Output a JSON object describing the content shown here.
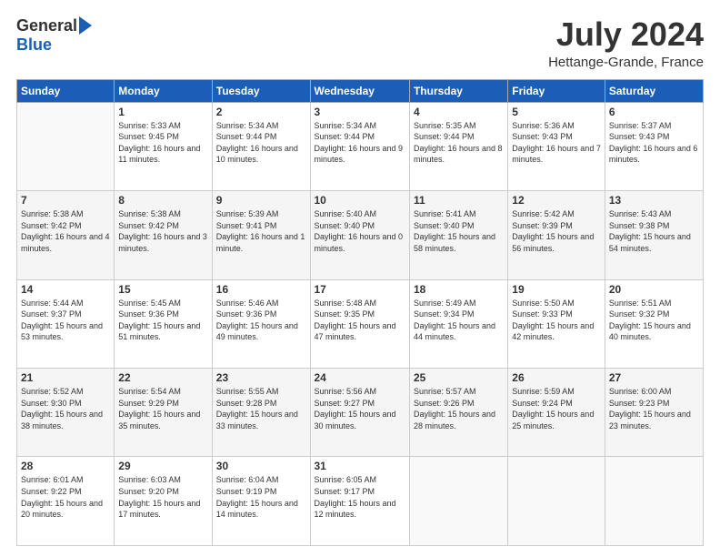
{
  "logo": {
    "general": "General",
    "blue": "Blue"
  },
  "header": {
    "month": "July 2024",
    "location": "Hettange-Grande, France"
  },
  "weekdays": [
    "Sunday",
    "Monday",
    "Tuesday",
    "Wednesday",
    "Thursday",
    "Friday",
    "Saturday"
  ],
  "weeks": [
    [
      {
        "day": "",
        "sunrise": "",
        "sunset": "",
        "daylight": ""
      },
      {
        "day": "1",
        "sunrise": "Sunrise: 5:33 AM",
        "sunset": "Sunset: 9:45 PM",
        "daylight": "Daylight: 16 hours and 11 minutes."
      },
      {
        "day": "2",
        "sunrise": "Sunrise: 5:34 AM",
        "sunset": "Sunset: 9:44 PM",
        "daylight": "Daylight: 16 hours and 10 minutes."
      },
      {
        "day": "3",
        "sunrise": "Sunrise: 5:34 AM",
        "sunset": "Sunset: 9:44 PM",
        "daylight": "Daylight: 16 hours and 9 minutes."
      },
      {
        "day": "4",
        "sunrise": "Sunrise: 5:35 AM",
        "sunset": "Sunset: 9:44 PM",
        "daylight": "Daylight: 16 hours and 8 minutes."
      },
      {
        "day": "5",
        "sunrise": "Sunrise: 5:36 AM",
        "sunset": "Sunset: 9:43 PM",
        "daylight": "Daylight: 16 hours and 7 minutes."
      },
      {
        "day": "6",
        "sunrise": "Sunrise: 5:37 AM",
        "sunset": "Sunset: 9:43 PM",
        "daylight": "Daylight: 16 hours and 6 minutes."
      }
    ],
    [
      {
        "day": "7",
        "sunrise": "Sunrise: 5:38 AM",
        "sunset": "Sunset: 9:42 PM",
        "daylight": "Daylight: 16 hours and 4 minutes."
      },
      {
        "day": "8",
        "sunrise": "Sunrise: 5:38 AM",
        "sunset": "Sunset: 9:42 PM",
        "daylight": "Daylight: 16 hours and 3 minutes."
      },
      {
        "day": "9",
        "sunrise": "Sunrise: 5:39 AM",
        "sunset": "Sunset: 9:41 PM",
        "daylight": "Daylight: 16 hours and 1 minute."
      },
      {
        "day": "10",
        "sunrise": "Sunrise: 5:40 AM",
        "sunset": "Sunset: 9:40 PM",
        "daylight": "Daylight: 16 hours and 0 minutes."
      },
      {
        "day": "11",
        "sunrise": "Sunrise: 5:41 AM",
        "sunset": "Sunset: 9:40 PM",
        "daylight": "Daylight: 15 hours and 58 minutes."
      },
      {
        "day": "12",
        "sunrise": "Sunrise: 5:42 AM",
        "sunset": "Sunset: 9:39 PM",
        "daylight": "Daylight: 15 hours and 56 minutes."
      },
      {
        "day": "13",
        "sunrise": "Sunrise: 5:43 AM",
        "sunset": "Sunset: 9:38 PM",
        "daylight": "Daylight: 15 hours and 54 minutes."
      }
    ],
    [
      {
        "day": "14",
        "sunrise": "Sunrise: 5:44 AM",
        "sunset": "Sunset: 9:37 PM",
        "daylight": "Daylight: 15 hours and 53 minutes."
      },
      {
        "day": "15",
        "sunrise": "Sunrise: 5:45 AM",
        "sunset": "Sunset: 9:36 PM",
        "daylight": "Daylight: 15 hours and 51 minutes."
      },
      {
        "day": "16",
        "sunrise": "Sunrise: 5:46 AM",
        "sunset": "Sunset: 9:36 PM",
        "daylight": "Daylight: 15 hours and 49 minutes."
      },
      {
        "day": "17",
        "sunrise": "Sunrise: 5:48 AM",
        "sunset": "Sunset: 9:35 PM",
        "daylight": "Daylight: 15 hours and 47 minutes."
      },
      {
        "day": "18",
        "sunrise": "Sunrise: 5:49 AM",
        "sunset": "Sunset: 9:34 PM",
        "daylight": "Daylight: 15 hours and 44 minutes."
      },
      {
        "day": "19",
        "sunrise": "Sunrise: 5:50 AM",
        "sunset": "Sunset: 9:33 PM",
        "daylight": "Daylight: 15 hours and 42 minutes."
      },
      {
        "day": "20",
        "sunrise": "Sunrise: 5:51 AM",
        "sunset": "Sunset: 9:32 PM",
        "daylight": "Daylight: 15 hours and 40 minutes."
      }
    ],
    [
      {
        "day": "21",
        "sunrise": "Sunrise: 5:52 AM",
        "sunset": "Sunset: 9:30 PM",
        "daylight": "Daylight: 15 hours and 38 minutes."
      },
      {
        "day": "22",
        "sunrise": "Sunrise: 5:54 AM",
        "sunset": "Sunset: 9:29 PM",
        "daylight": "Daylight: 15 hours and 35 minutes."
      },
      {
        "day": "23",
        "sunrise": "Sunrise: 5:55 AM",
        "sunset": "Sunset: 9:28 PM",
        "daylight": "Daylight: 15 hours and 33 minutes."
      },
      {
        "day": "24",
        "sunrise": "Sunrise: 5:56 AM",
        "sunset": "Sunset: 9:27 PM",
        "daylight": "Daylight: 15 hours and 30 minutes."
      },
      {
        "day": "25",
        "sunrise": "Sunrise: 5:57 AM",
        "sunset": "Sunset: 9:26 PM",
        "daylight": "Daylight: 15 hours and 28 minutes."
      },
      {
        "day": "26",
        "sunrise": "Sunrise: 5:59 AM",
        "sunset": "Sunset: 9:24 PM",
        "daylight": "Daylight: 15 hours and 25 minutes."
      },
      {
        "day": "27",
        "sunrise": "Sunrise: 6:00 AM",
        "sunset": "Sunset: 9:23 PM",
        "daylight": "Daylight: 15 hours and 23 minutes."
      }
    ],
    [
      {
        "day": "28",
        "sunrise": "Sunrise: 6:01 AM",
        "sunset": "Sunset: 9:22 PM",
        "daylight": "Daylight: 15 hours and 20 minutes."
      },
      {
        "day": "29",
        "sunrise": "Sunrise: 6:03 AM",
        "sunset": "Sunset: 9:20 PM",
        "daylight": "Daylight: 15 hours and 17 minutes."
      },
      {
        "day": "30",
        "sunrise": "Sunrise: 6:04 AM",
        "sunset": "Sunset: 9:19 PM",
        "daylight": "Daylight: 15 hours and 14 minutes."
      },
      {
        "day": "31",
        "sunrise": "Sunrise: 6:05 AM",
        "sunset": "Sunset: 9:17 PM",
        "daylight": "Daylight: 15 hours and 12 minutes."
      },
      {
        "day": "",
        "sunrise": "",
        "sunset": "",
        "daylight": ""
      },
      {
        "day": "",
        "sunrise": "",
        "sunset": "",
        "daylight": ""
      },
      {
        "day": "",
        "sunrise": "",
        "sunset": "",
        "daylight": ""
      }
    ]
  ]
}
